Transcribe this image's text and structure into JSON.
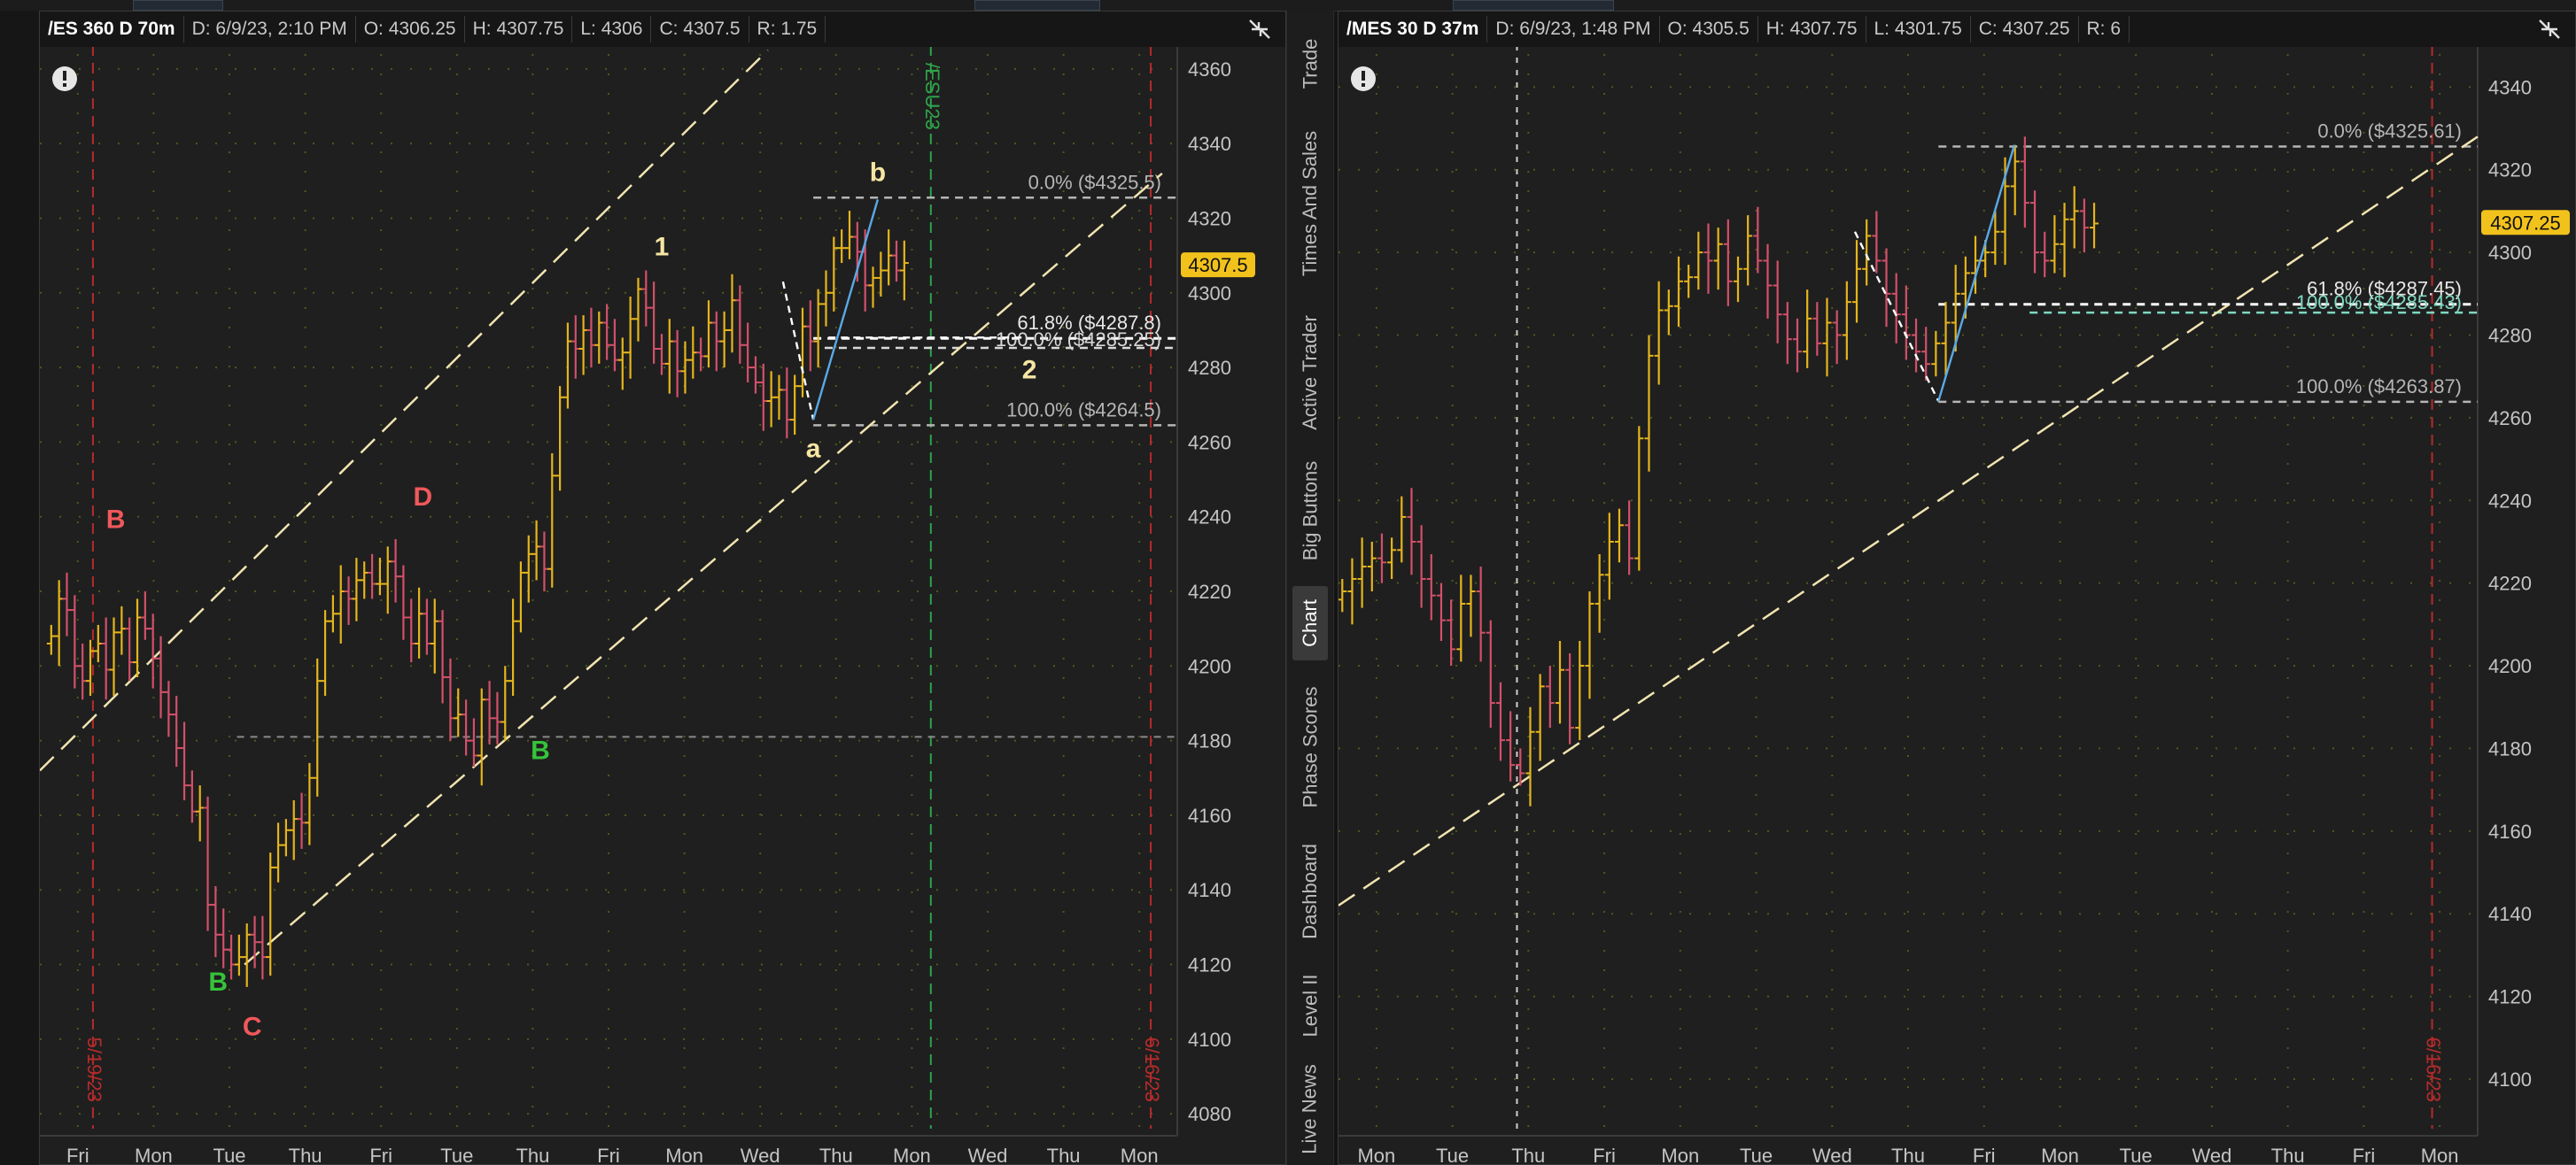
{
  "colors": {
    "background": "#1f1f1f",
    "grid_dot": "#4b5a1e",
    "candle_up": "#e5b51c",
    "candle_down": "#d2506a",
    "price_badge": "#f2c21c",
    "channel": "#f1e4b0",
    "fib": "#b5b5b5",
    "label_red": "#f0585b",
    "label_green": "#36c23a",
    "label_yellow": "#f6e6a3",
    "expiry_green": "#2ea34a",
    "date_red": "#b52b2b",
    "trend_blue": "#5aa9e6"
  },
  "sidebar": {
    "tabs": [
      {
        "label": "Trade",
        "active": false
      },
      {
        "label": "Times And Sales",
        "active": false
      },
      {
        "label": "Active Trader",
        "active": false
      },
      {
        "label": "Big Buttons",
        "active": false
      },
      {
        "label": "Chart",
        "active": true
      },
      {
        "label": "Phase Scores",
        "active": false
      },
      {
        "label": "Dashboard",
        "active": false
      },
      {
        "label": "Level II",
        "active": false
      },
      {
        "label": "Live News",
        "active": false
      }
    ]
  },
  "chart_left": {
    "header": {
      "symbol": "/ES 360 D 70m",
      "date": "D: 6/9/23, 2:10 PM",
      "open": "O: 4306.25",
      "high": "H: 4307.75",
      "low": "L: 4306",
      "close": "C: 4307.5",
      "range": "R: 1.75"
    },
    "icons": [
      "alert-icon",
      "collapse-arrows-icon"
    ],
    "price_badge": "4307.5",
    "expiry_label": "/ESU23",
    "date_labels": [
      "5/19/23",
      "6/16/23"
    ]
  },
  "chart_right": {
    "header": {
      "symbol": "/MES 30 D 37m",
      "date": "D: 6/9/23, 1:48 PM",
      "open": "O: 4305.5",
      "high": "H: 4307.75",
      "low": "L: 4301.75",
      "close": "C: 4307.25",
      "range": "R: 6"
    },
    "icons": [
      "alert-icon",
      "collapse-arrows-icon"
    ],
    "price_badge": "4307.25",
    "date_labels": [
      "6/16/23"
    ]
  },
  "chart_data": [
    {
      "type": "line",
      "subtype": "candlestick",
      "title": "/ES 360 D 70m",
      "x_ticks": [
        "Fri",
        "Mon",
        "Tue",
        "Thu",
        "Fri",
        "Tue",
        "Thu",
        "Fri",
        "Mon",
        "Wed",
        "Thu",
        "Mon",
        "Wed",
        "Thu",
        "Mon"
      ],
      "y_ticks": [
        4080,
        4100,
        4120,
        4140,
        4160,
        4180,
        4200,
        4220,
        4240,
        4260,
        4280,
        4300,
        4320,
        4340,
        4360
      ],
      "ylim": [
        4076,
        4364
      ],
      "x_range": [
        0,
        15
      ],
      "grid": true,
      "series": [
        {
          "values": [
            4208,
            4218,
            4215,
            4200,
            4196,
            4204,
            4206,
            4199,
            4209,
            4210,
            4201,
            4213,
            4210,
            4202,
            4193,
            4187,
            4178,
            4168,
            4161,
            4162,
            4136,
            4128,
            4124,
            4120,
            4122,
            4128,
            4126,
            4122,
            4146,
            4152,
            4156,
            4159,
            4158,
            4170,
            4196,
            4212,
            4214,
            4220,
            4218,
            4223,
            4225,
            4222,
            4222,
            4228,
            4224,
            4213,
            4206,
            4214,
            4206,
            4212,
            4197,
            4186,
            4187,
            4180,
            4176,
            4191,
            4186,
            4185,
            4196,
            4212,
            4225,
            4230,
            4232,
            4226,
            4251,
            4272,
            4287,
            4285,
            4290,
            4286,
            4292,
            4286,
            4282,
            4284,
            4293,
            4301,
            4296,
            4285,
            4281,
            4287,
            4279,
            4282,
            4284,
            4283,
            4292,
            4287,
            4290,
            4298,
            4286,
            4280,
            4276,
            4271,
            4272,
            4274,
            4266,
            4275,
            4291,
            4287,
            4297,
            4300,
            4312,
            4312,
            4315,
            4311,
            4302,
            4304,
            4306,
            4310,
            4306,
            4308
          ]
        }
      ],
      "levels": [
        {
          "label": "0.0%",
          "value": 4325.5,
          "text": "0.0%  ($4325.5)"
        },
        {
          "label": "61.8%",
          "value": 4287.8,
          "text": "61.8%  ($4287.8)"
        },
        {
          "label": "100.0%",
          "value": 4285.25,
          "text": "100.0%  ($4285.25)"
        },
        {
          "label": "100.0%",
          "value": 4264.5,
          "text": "100.0%  ($4264.5)"
        },
        {
          "label": "horizontal",
          "value": 4181
        }
      ],
      "channel_lines": [
        {
          "from": [
            0,
            4172
          ],
          "to": [
            9.6,
            4365
          ]
        },
        {
          "from": [
            2.7,
            4120
          ],
          "to": [
            14.8,
            4332
          ]
        }
      ],
      "annotations": [
        {
          "text": "B",
          "x": 1.0,
          "y": 4237,
          "color": "red"
        },
        {
          "text": "B",
          "x": 2.35,
          "y": 4113,
          "color": "green"
        },
        {
          "text": "C",
          "x": 2.8,
          "y": 4101,
          "color": "red"
        },
        {
          "text": "D",
          "x": 5.05,
          "y": 4243,
          "color": "red"
        },
        {
          "text": "B",
          "x": 6.6,
          "y": 4175,
          "color": "green"
        },
        {
          "text": "1",
          "x": 8.2,
          "y": 4310,
          "color": "yellow"
        },
        {
          "text": "a",
          "x": 10.2,
          "y": 4256,
          "color": "yellow"
        },
        {
          "text": "b",
          "x": 11.05,
          "y": 4330,
          "color": "yellow"
        },
        {
          "text": "2",
          "x": 13.05,
          "y": 4277,
          "color": "yellow"
        }
      ],
      "vertical_markers": [
        {
          "label": "5/19/23",
          "x": 0.7
        },
        {
          "label": "/ESU23",
          "x": 11.75
        },
        {
          "label": "6/16/23",
          "x": 14.65
        }
      ],
      "last_price": 4307.5
    },
    {
      "type": "line",
      "subtype": "candlestick",
      "title": "/MES 30 D 37m",
      "x_ticks": [
        "Mon",
        "Tue",
        "Thu",
        "Fri",
        "Mon",
        "Tue",
        "Wed",
        "Thu",
        "Fri",
        "Mon",
        "Tue",
        "Wed",
        "Thu",
        "Fri",
        "Mon"
      ],
      "y_ticks": [
        4100,
        4120,
        4140,
        4160,
        4180,
        4200,
        4220,
        4240,
        4260,
        4280,
        4300,
        4320,
        4340
      ],
      "ylim": [
        4088,
        4348
      ],
      "x_range": [
        0,
        15
      ],
      "grid": true,
      "series": [
        {
          "values": [
            4218,
            4221,
            4224,
            4226,
            4225,
            4228,
            4236,
            4230,
            4221,
            4217,
            4211,
            4204,
            4215,
            4218,
            4208,
            4191,
            4182,
            4176,
            4174,
            4184,
            4195,
            4191,
            4199,
            4185,
            4200,
            4215,
            4222,
            4230,
            4234,
            4226,
            4255,
            4275,
            4286,
            4287,
            4293,
            4294,
            4300,
            4298,
            4302,
            4293,
            4296,
            4304,
            4298,
            4292,
            4285,
            4279,
            4276,
            4284,
            4278,
            4283,
            4280,
            4288,
            4296,
            4304,
            4298,
            4290,
            4285,
            4280,
            4276,
            4273,
            4278,
            4283,
            4290,
            4295,
            4298,
            4300,
            4305,
            4316,
            4322,
            4312,
            4300,
            4298,
            4302,
            4308,
            4310,
            4306,
            4307
          ]
        }
      ],
      "levels": [
        {
          "label": "0.0%",
          "value": 4325.61,
          "text": "0.0%  ($4325.61)"
        },
        {
          "label": "61.8%",
          "value": 4287.45,
          "text": "61.8%  ($4287.45)"
        },
        {
          "label": "100.0%",
          "value": 4285.43,
          "text": "100.0%  ($4285.43)"
        },
        {
          "label": "100.0%",
          "value": 4263.87,
          "text": "100.0%  ($4263.87)"
        }
      ],
      "channel_lines": [
        {
          "from": [
            0,
            4142
          ],
          "to": [
            15,
            4328
          ]
        }
      ],
      "annotations": [],
      "vertical_markers": [
        {
          "label": "",
          "x": 2.35
        },
        {
          "label": "6/16/23",
          "x": 14.4
        }
      ],
      "last_price": 4307.25
    }
  ]
}
